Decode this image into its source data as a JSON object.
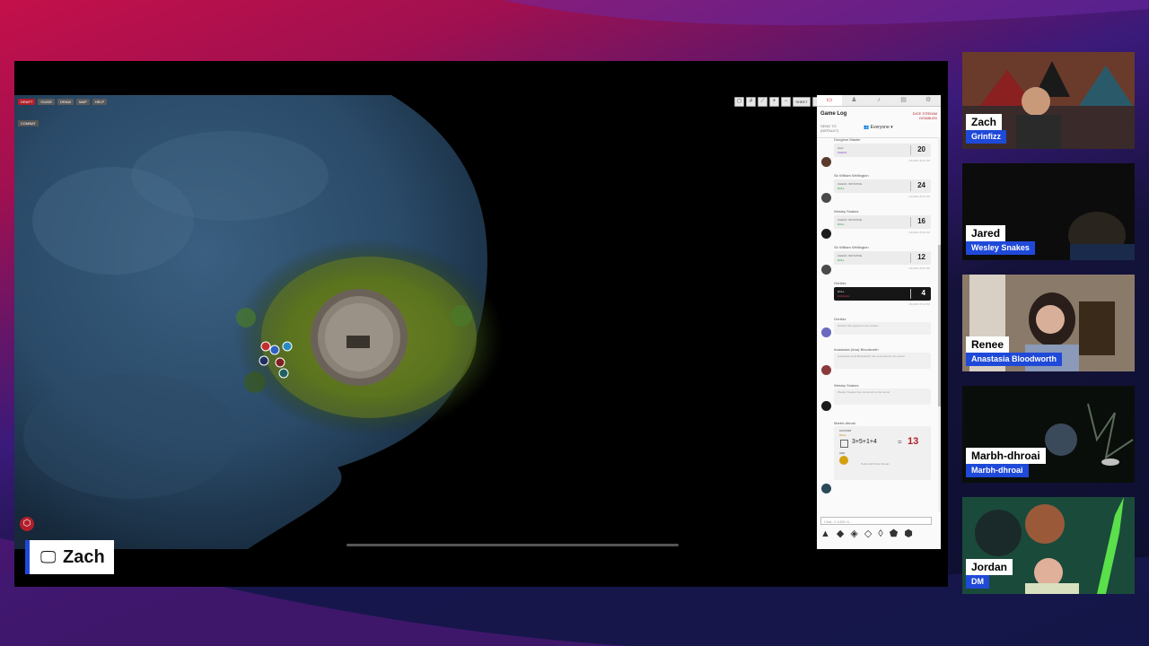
{
  "colors": {
    "accent_blue": "#1f49d8",
    "vtt_red": "#b01f2a",
    "bg_magenta": "#c4104a",
    "bg_navy": "#0c0e2e"
  },
  "map_toolbar": {
    "buttons": [
      "DRAFT",
      "GUIDE",
      "DRAW",
      "MAP",
      "HELP"
    ],
    "combat_label": "COMBAT",
    "top_tools": [
      "view-icon",
      "grid-icon",
      "ruler-icon",
      "zoom-icon",
      "zoom-out-icon"
    ],
    "tool_text": "SHEET"
  },
  "sidebar": {
    "tabs": [
      "chat-icon",
      "person-icon",
      "sound-icon",
      "journal-icon",
      "settings-icon"
    ],
    "title": "Game Log",
    "dice_stream": "DICE STREAM\nDISABLED",
    "send_to_label": "SEND TO\n(DEFAULT)",
    "send_to_value": "Everyone",
    "entries": [
      {
        "who": "Dungeon Master",
        "line1": "CHA",
        "line2": "CHECK",
        "value": "20",
        "ts": "4/1/2024 8:31 PM"
      },
      {
        "who": "Sir William Wellington",
        "line1": "CHECK: INITIATIVE",
        "line2": "ROLL",
        "value": "24",
        "ts": "4/1/2024 8:31 PM"
      },
      {
        "who": "Wesley Snakes",
        "line1": "CHECK: INITIATIVE",
        "line2": "ROLL",
        "value": "16",
        "ts": "4/1/2024 8:31 PM"
      },
      {
        "who": "Sir William Wellington",
        "line1": "CHECK: INITIATIVE",
        "line2": "ROLL",
        "value": "12",
        "ts": "4/1/2024 8:31 PM"
      },
      {
        "who": "Grinfizz",
        "line1": "ROLL",
        "line2": "DAMAGE",
        "value": "4",
        "ts": "4/1/2024 8:31 PM"
      }
    ],
    "system_msgs": [
      {
        "who": "Grinfizz",
        "text": "Grinfizz has rejoined to the stream"
      },
      {
        "who": "Anastasia (Ana) Bloodworth",
        "text": "Anastasia (Ana) Bloodworth has connected to the server"
      },
      {
        "who": "Wesley Snakes",
        "text": "Wesley Snakes has connected to the server"
      }
    ],
    "big_roll": {
      "who": "Marbh-dhroai",
      "label1": "CUSTOM",
      "label2": "ROLL",
      "expression": "3+5+1+4",
      "equals": "=",
      "total": "13",
      "label3": "ADD",
      "note": "Rolled with Dice Stream"
    },
    "chat_placeholder": "Chat, /r 1d20+4...",
    "dice_icons": [
      "d4-icon",
      "d6-icon",
      "d8-icon",
      "d10-icon",
      "d100-icon",
      "d12-icon",
      "d20-icon"
    ]
  },
  "presenter": {
    "name": "Zach"
  },
  "cams": [
    {
      "name": "Zach",
      "character": "Grinfizz"
    },
    {
      "name": "Jared",
      "character": "Wesley Snakes"
    },
    {
      "name": "Renee",
      "character": "Anastasia Bloodworth"
    },
    {
      "name": "Marbh-dhroai",
      "character": "Marbh-dhroai"
    },
    {
      "name": "Jordan",
      "character": "DM"
    }
  ]
}
